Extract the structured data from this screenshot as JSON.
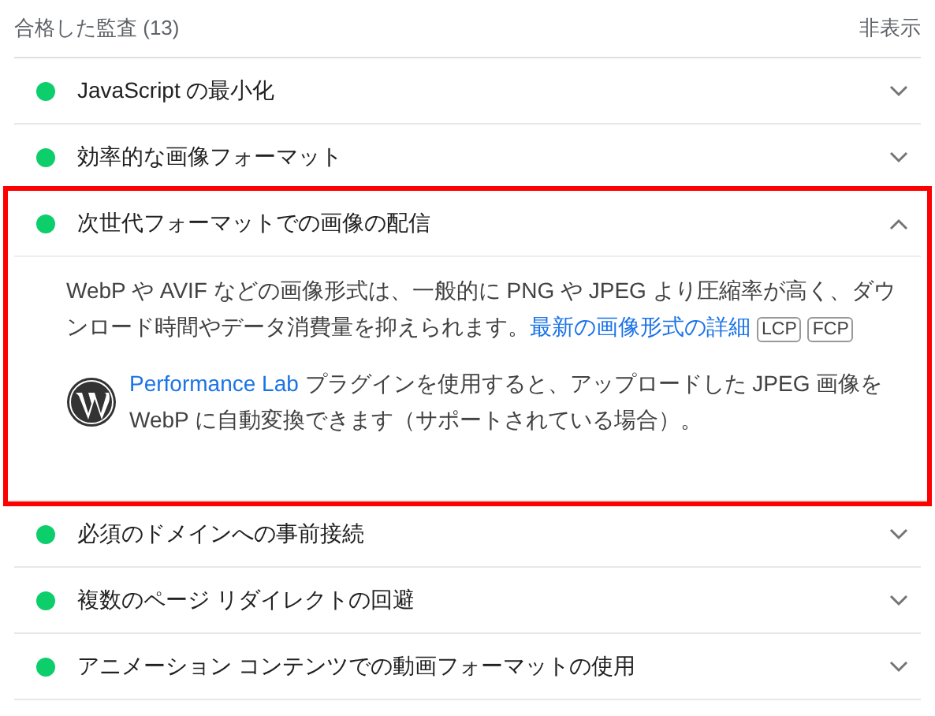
{
  "section": {
    "title": "合格した監査",
    "count": "(13)",
    "toggle": "非表示"
  },
  "audits": [
    {
      "title": "JavaScript の最小化",
      "expanded": false,
      "highlighted": false
    },
    {
      "title": "効率的な画像フォーマット",
      "expanded": false,
      "highlighted": false
    },
    {
      "title": "次世代フォーマットでの画像の配信",
      "expanded": true,
      "highlighted": true,
      "details": {
        "description": "WebP や AVIF などの画像形式は、一般的に PNG や JPEG より圧縮率が高く、ダウンロード時間やデータ消費量を抑えられます。",
        "link": "最新の画像形式の詳細",
        "badges": [
          "LCP",
          "FCP"
        ],
        "note": {
          "link": "Performance Lab",
          "text": " プラグインを使用すると、アップロードした JPEG 画像を WebP に自動変換できます（サポートされている場合）。"
        }
      }
    },
    {
      "title": "必須のドメインへの事前接続",
      "expanded": false,
      "highlighted": false
    },
    {
      "title": "複数のページ リダイレクトの回避",
      "expanded": false,
      "highlighted": false
    },
    {
      "title": "アニメーション コンテンツでの動画フォーマットの使用",
      "expanded": false,
      "highlighted": false
    }
  ]
}
